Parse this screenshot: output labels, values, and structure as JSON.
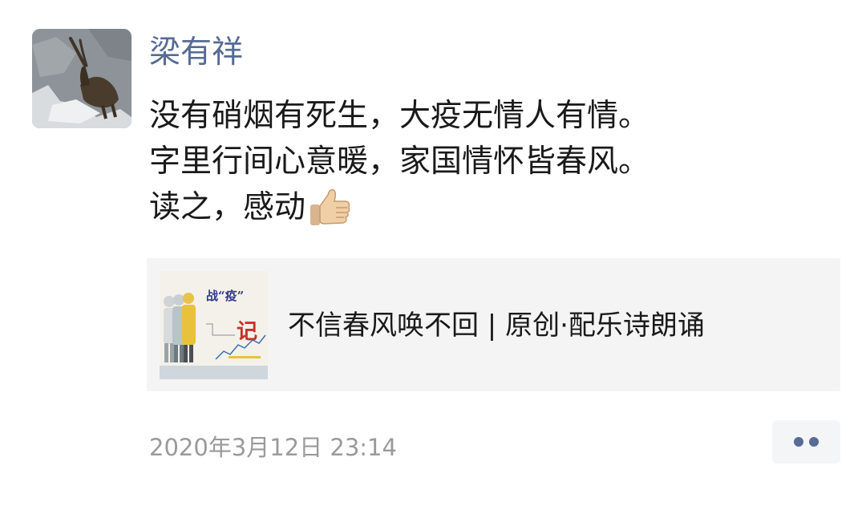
{
  "post": {
    "author": "梁有祥",
    "avatar_icon": "ibex-on-rock-avatar",
    "lines": [
      "没有硝烟有死生，大疫无情人有情。",
      "字里行间心意暖，家国情怀皆春风。",
      "读之，感动"
    ],
    "emoji_icon": "thumbs-up-icon",
    "timestamp": "2020年3月12日 23:14"
  },
  "link_card": {
    "title": "不信春风唤不回 | 原创·配乐诗朗诵",
    "thumb_caption_1": "战“疫”",
    "thumb_caption_2": "记"
  },
  "actions": {
    "more_icon": "more-dots-icon"
  },
  "colors": {
    "author_name": "#576b95",
    "body_text": "#1a1a1a",
    "timestamp": "#9a9a9a",
    "card_background": "#f4f4f4",
    "thumb_red": "#c8302a"
  }
}
